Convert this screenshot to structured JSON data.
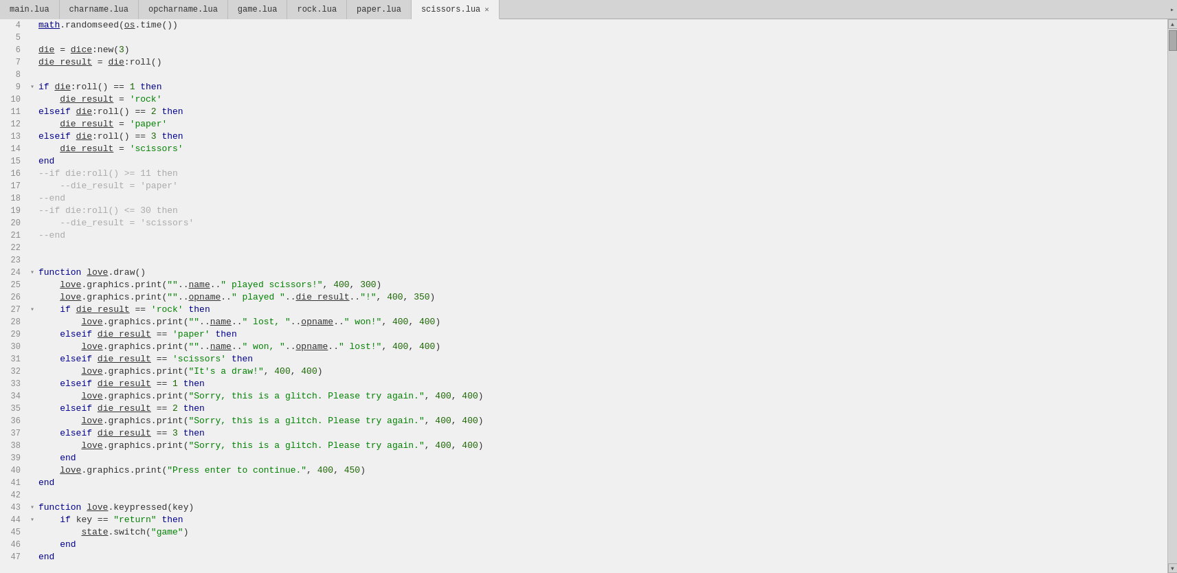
{
  "tabs": [
    {
      "label": "main.lua",
      "active": false,
      "closeable": false
    },
    {
      "label": "charname.lua",
      "active": false,
      "closeable": false
    },
    {
      "label": "opcharname.lua",
      "active": false,
      "closeable": false
    },
    {
      "label": "game.lua",
      "active": false,
      "closeable": false
    },
    {
      "label": "rock.lua",
      "active": false,
      "closeable": false
    },
    {
      "label": "paper.lua",
      "active": false,
      "closeable": false
    },
    {
      "label": "scissors.lua",
      "active": true,
      "closeable": true
    }
  ],
  "lines": [
    {
      "num": 4,
      "fold": "",
      "content": "math.randomseed(os.time())"
    },
    {
      "num": 5,
      "fold": "",
      "content": ""
    },
    {
      "num": 6,
      "fold": "",
      "content": "die = dice:new(3)"
    },
    {
      "num": 7,
      "fold": "",
      "content": "die_result = die:roll()"
    },
    {
      "num": 8,
      "fold": "",
      "content": ""
    },
    {
      "num": 9,
      "fold": "▾",
      "content": "if die:roll() == 1 then"
    },
    {
      "num": 10,
      "fold": "",
      "content": "    die_result = 'rock'"
    },
    {
      "num": 11,
      "fold": "",
      "content": "elseif die:roll() == 2 then"
    },
    {
      "num": 12,
      "fold": "",
      "content": "    die_result = 'paper'"
    },
    {
      "num": 13,
      "fold": "",
      "content": "elseif die:roll() == 3 then"
    },
    {
      "num": 14,
      "fold": "",
      "content": "    die_result = 'scissors'"
    },
    {
      "num": 15,
      "fold": "",
      "content": "end"
    },
    {
      "num": 16,
      "fold": "",
      "content": "--if die:roll() >= 11 then"
    },
    {
      "num": 17,
      "fold": "",
      "content": "    --die_result = 'paper'"
    },
    {
      "num": 18,
      "fold": "",
      "content": "--end"
    },
    {
      "num": 19,
      "fold": "",
      "content": "--if die:roll() <= 30 then"
    },
    {
      "num": 20,
      "fold": "",
      "content": "    --die_result = 'scissors'"
    },
    {
      "num": 21,
      "fold": "",
      "content": "--end"
    },
    {
      "num": 22,
      "fold": "",
      "content": ""
    },
    {
      "num": 23,
      "fold": "",
      "content": ""
    },
    {
      "num": 24,
      "fold": "▾",
      "content": "function love.draw()"
    },
    {
      "num": 25,
      "fold": "",
      "content": "    love.graphics.print(\"\"..name..\" played scissors!\", 400, 300)"
    },
    {
      "num": 26,
      "fold": "",
      "content": "    love.graphics.print(\"\"..opname..\" played \"..die_result..\"!\", 400, 350)"
    },
    {
      "num": 27,
      "fold": "▾",
      "content": "    if die_result == 'rock' then"
    },
    {
      "num": 28,
      "fold": "",
      "content": "        love.graphics.print(\"\"..name..\" lost, \"..opname..\" won!\", 400, 400)"
    },
    {
      "num": 29,
      "fold": "",
      "content": "    elseif die_result == 'paper' then"
    },
    {
      "num": 30,
      "fold": "",
      "content": "        love.graphics.print(\"\"..name..\" won, \"..opname..\" lost!\", 400, 400)"
    },
    {
      "num": 31,
      "fold": "",
      "content": "    elseif die_result == 'scissors' then"
    },
    {
      "num": 32,
      "fold": "",
      "content": "        love.graphics.print(\"It's a draw!\", 400, 400)"
    },
    {
      "num": 33,
      "fold": "",
      "content": "    elseif die_result == 1 then"
    },
    {
      "num": 34,
      "fold": "",
      "content": "        love.graphics.print(\"Sorry, this is a glitch. Please try again.\", 400, 400)"
    },
    {
      "num": 35,
      "fold": "",
      "content": "    elseif die_result == 2 then"
    },
    {
      "num": 36,
      "fold": "",
      "content": "        love.graphics.print(\"Sorry, this is a glitch. Please try again.\", 400, 400)"
    },
    {
      "num": 37,
      "fold": "",
      "content": "    elseif die_result == 3 then"
    },
    {
      "num": 38,
      "fold": "",
      "content": "        love.graphics.print(\"Sorry, this is a glitch. Please try again.\", 400, 400)"
    },
    {
      "num": 39,
      "fold": "",
      "content": "    end"
    },
    {
      "num": 40,
      "fold": "",
      "content": "    love.graphics.print(\"Press enter to continue.\", 400, 450)"
    },
    {
      "num": 41,
      "fold": "",
      "content": "end"
    },
    {
      "num": 42,
      "fold": "",
      "content": ""
    },
    {
      "num": 43,
      "fold": "▾",
      "content": "function love.keypressed(key)"
    },
    {
      "num": 44,
      "fold": "▾",
      "content": "    if key == \"return\" then"
    },
    {
      "num": 45,
      "fold": "",
      "content": "        state.switch(\"game\")"
    },
    {
      "num": 46,
      "fold": "",
      "content": "    end"
    },
    {
      "num": 47,
      "fold": "",
      "content": "end"
    }
  ]
}
